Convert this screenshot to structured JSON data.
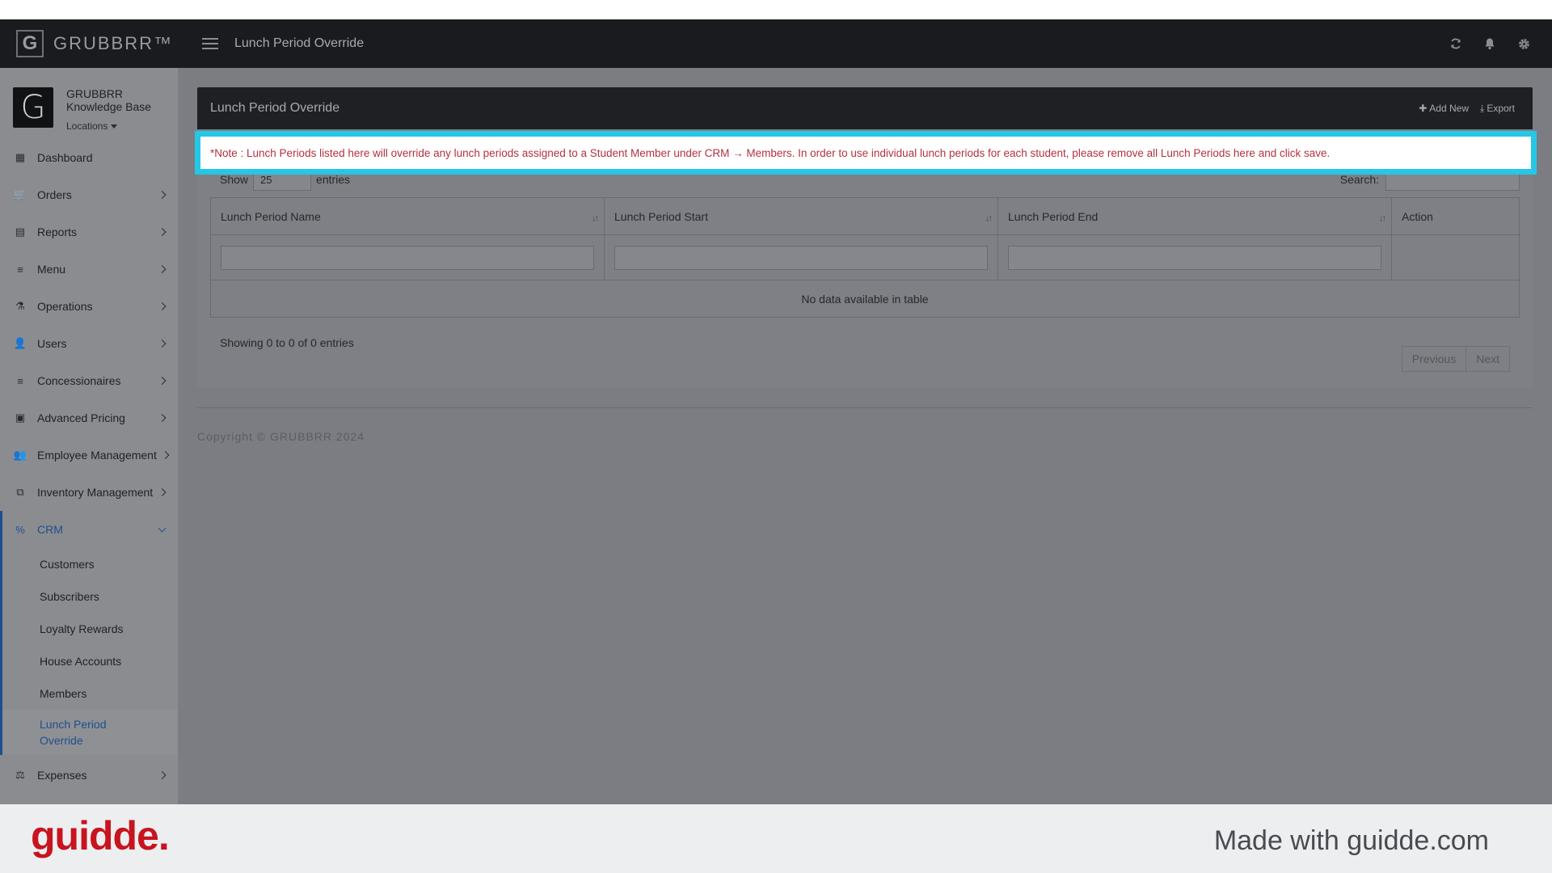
{
  "brand": {
    "logo_letter": "G",
    "name": "GRUBBRR™"
  },
  "profile": {
    "avatar_letter": "G",
    "name_line1": "GRUBBRR",
    "name_line2": "Knowledge Base",
    "locations_label": "Locations"
  },
  "sidebar": {
    "items": [
      {
        "label": "Dashboard",
        "icon": "dashboard-icon",
        "glyph": "▦"
      },
      {
        "label": "Orders",
        "icon": "cart-icon",
        "glyph": "🛒"
      },
      {
        "label": "Reports",
        "icon": "report-icon",
        "glyph": "▤"
      },
      {
        "label": "Menu",
        "icon": "list-icon",
        "glyph": "≡"
      },
      {
        "label": "Operations",
        "icon": "flask-icon",
        "glyph": "⚗"
      },
      {
        "label": "Users",
        "icon": "user-add-icon",
        "glyph": "👤"
      },
      {
        "label": "Concessionaires",
        "icon": "list-icon",
        "glyph": "≡"
      },
      {
        "label": "Advanced Pricing",
        "icon": "money-icon",
        "glyph": "▣"
      },
      {
        "label": "Employee Management",
        "icon": "users-icon",
        "glyph": "👥"
      },
      {
        "label": "Inventory Management",
        "icon": "sitemap-icon",
        "glyph": "⧉"
      },
      {
        "label": "CRM",
        "icon": "link-icon",
        "glyph": "%"
      }
    ],
    "crm_subitems": [
      "Customers",
      "Subscribers",
      "Loyalty Rewards",
      "House Accounts",
      "Members"
    ],
    "crm_current": {
      "line1": "Lunch Period",
      "line2": "Override"
    },
    "expenses": {
      "label": "Expenses",
      "icon": "scale-icon",
      "glyph": "⚖"
    }
  },
  "topbar": {
    "title": "Lunch Period Override"
  },
  "panel": {
    "title": "Lunch Period Override",
    "add_new": "Add New",
    "export": "Export",
    "show_label": "Show",
    "entries_select": "25",
    "entries_label": "entries",
    "search_label": "Search:",
    "columns": [
      "Lunch Period Name",
      "Lunch Period Start",
      "Lunch Period End",
      "Action"
    ],
    "empty_message": "No data available in table",
    "info": "Showing 0 to 0 of 0 entries",
    "prev": "Previous",
    "next": "Next"
  },
  "note": "*Note : Lunch Periods listed here will override any lunch periods assigned to a Student Member under CRM → Members. In order to use individual lunch periods for each student, please remove all Lunch Periods here and click save.",
  "copyright": "Copyright © GRUBBRR 2024",
  "footer": {
    "logo": "guidde.",
    "made_with": "Made with guidde.com"
  },
  "colors": {
    "highlight": "#25c6e6",
    "note_text": "#b5303d",
    "active_link": "#1d4f8f",
    "guidde_red": "#c7141e"
  }
}
